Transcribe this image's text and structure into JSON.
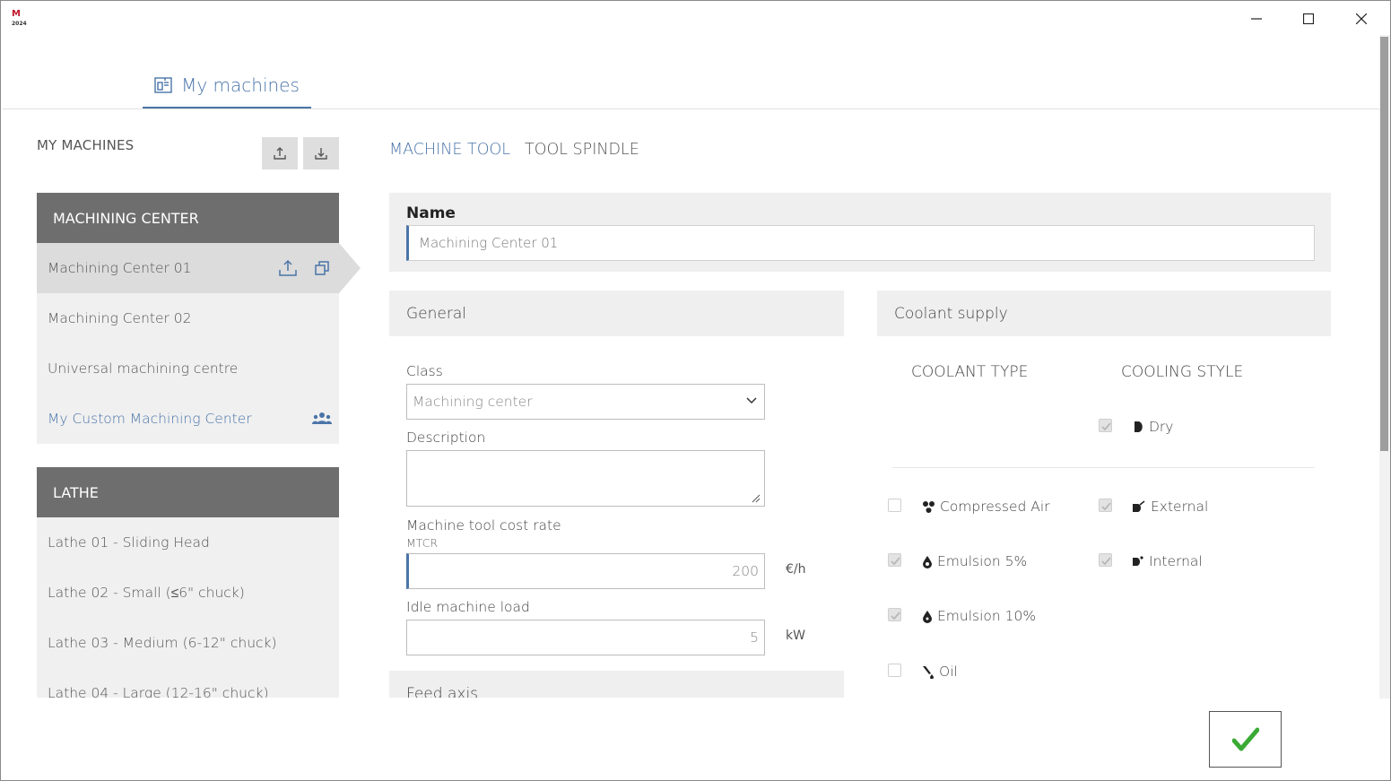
{
  "app": {
    "logo_text": "M",
    "logo_year": "2024"
  },
  "main_tab": {
    "label": "My machines",
    "icon": "machine-icon"
  },
  "left_panel": {
    "title": "MY MACHINES",
    "export_icon": "upload-icon",
    "import_icon": "download-icon",
    "groups": [
      {
        "header": "MACHINING CENTER",
        "items": [
          {
            "label": "Machining Center 01",
            "selected": true
          },
          {
            "label": "Machining Center 02"
          },
          {
            "label": "Universal machining centre"
          },
          {
            "label": "My Custom Machining Center",
            "custom": true
          }
        ]
      },
      {
        "header": "LATHE",
        "items": [
          {
            "label": "Lathe 01 - Sliding Head"
          },
          {
            "label": "Lathe 02 - Small (≤6\" chuck)"
          },
          {
            "label": "Lathe 03 - Medium (6-12\" chuck)"
          },
          {
            "label": "Lathe 04 - Large (12-16\" chuck)"
          }
        ]
      }
    ]
  },
  "sub_tabs": {
    "machine_tool": "MACHINE TOOL",
    "tool_spindle": "TOOL SPINDLE"
  },
  "name_section": {
    "label": "Name",
    "value": "Machining Center 01"
  },
  "general": {
    "header": "General",
    "class_label": "Class",
    "class_value": "Machining center",
    "description_label": "Description",
    "description_value": "",
    "cost_rate_label": "Machine tool cost rate",
    "cost_rate_sub": "MTCR",
    "cost_rate_value": "200",
    "cost_rate_unit": "€/h",
    "idle_load_label": "Idle machine load",
    "idle_load_value": "5",
    "idle_load_unit": "kW"
  },
  "feed_axis": {
    "header": "Feed axis"
  },
  "coolant": {
    "header": "Coolant supply",
    "type_title": "COOLANT TYPE",
    "style_title": "COOLING STYLE",
    "types": [
      {
        "label": "Compressed Air",
        "checked": false
      },
      {
        "label": "Emulsion 5%",
        "checked": true
      },
      {
        "label": "Emulsion 10%",
        "checked": true
      },
      {
        "label": "Oil",
        "checked": false
      }
    ],
    "styles": [
      {
        "label": "Dry",
        "checked": true
      },
      {
        "label": "External",
        "checked": true
      },
      {
        "label": "Internal",
        "checked": true
      }
    ]
  },
  "colors": {
    "accent": "#4a74a8",
    "group_header": "#6e6e6e",
    "confirm": "#3aaa35"
  }
}
